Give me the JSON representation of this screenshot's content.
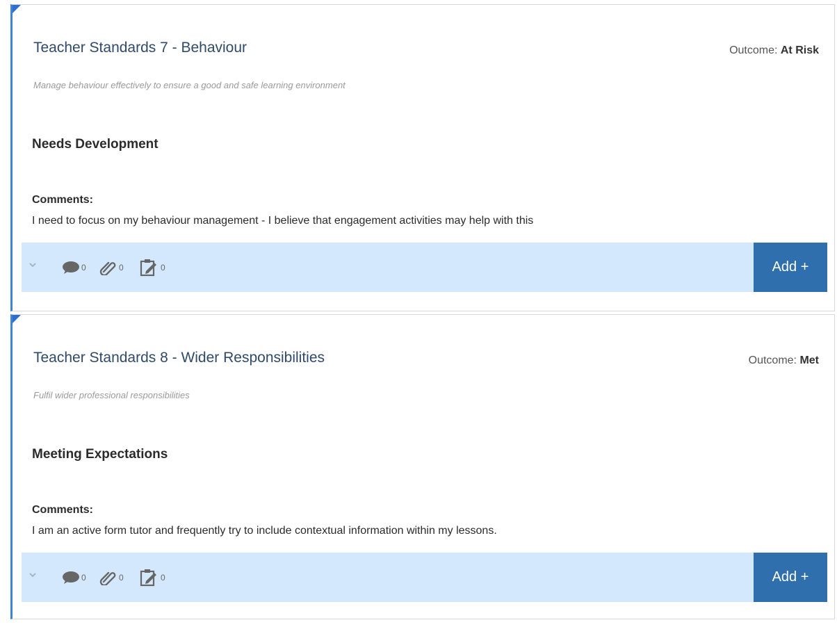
{
  "cards": [
    {
      "title": "Teacher Standards 7 - Behaviour",
      "outcome_label": "Outcome:",
      "outcome_value": "At Risk",
      "description": "Manage behaviour effectively to ensure a good and safe learning environment",
      "level": "Needs Development",
      "comments_label": "Comments:",
      "comments_text": "I need to focus on my behaviour management - I believe that engagement activities may help with this",
      "comment_count": "0",
      "attachment_count": "0",
      "task_count": "0",
      "add_label": "Add +"
    },
    {
      "title": "Teacher Standards 8 - Wider Responsibilities",
      "outcome_label": "Outcome:",
      "outcome_value": "Met",
      "description": "Fulfil wider professional responsibilities",
      "level": "Meeting Expectations",
      "comments_label": "Comments:",
      "comments_text": "I am an active form tutor and frequently try to include contextual information within my lessons.",
      "comment_count": "0",
      "attachment_count": "0",
      "task_count": "0",
      "add_label": "Add +"
    }
  ],
  "colors": {
    "accent": "#3a86d4",
    "bar_background": "#d3e8fd",
    "button": "#2f6fad"
  },
  "icons": [
    "chevron-down-icon",
    "comment-icon",
    "paperclip-icon",
    "clipboard-edit-icon"
  ]
}
